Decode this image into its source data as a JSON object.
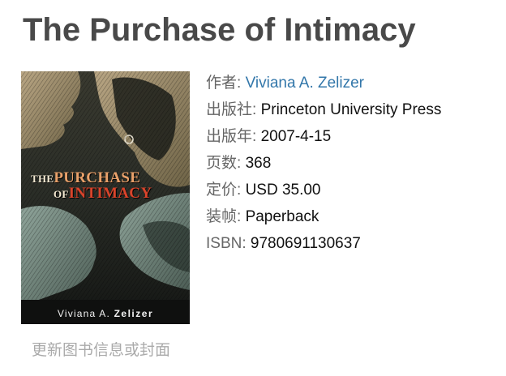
{
  "book": {
    "title": "The Purchase of Intimacy",
    "cover": {
      "title_prefix": "The",
      "title_big": "Purchase",
      "title_of": "of",
      "title_big2": "Intimacy",
      "author_first": "Viviana A.",
      "author_last": "Zelizer"
    }
  },
  "info": {
    "author": {
      "label": "作者:",
      "value": "Viviana A. Zelizer"
    },
    "publisher": {
      "label": "出版社:",
      "value": "Princeton University Press"
    },
    "pubdate": {
      "label": "出版年:",
      "value": "2007-4-15"
    },
    "pages": {
      "label": "页数:",
      "value": "368"
    },
    "price": {
      "label": "定价:",
      "value": "USD 35.00"
    },
    "binding": {
      "label": "装帧:",
      "value": "Paperback"
    },
    "isbn": {
      "label": "ISBN:",
      "value": "9780691130637"
    }
  },
  "actions": {
    "update_label": "更新图书信息或封面"
  },
  "colors": {
    "title": "#494949",
    "link": "#3377aa",
    "label": "#666666",
    "muted": "#aaaaaa"
  }
}
